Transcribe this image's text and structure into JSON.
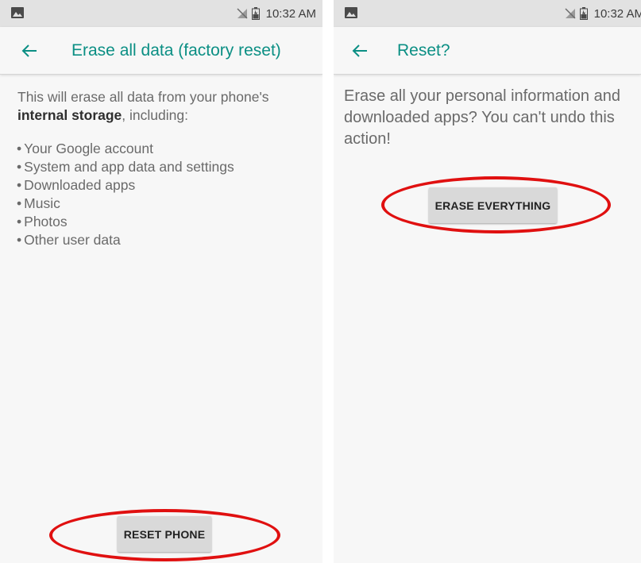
{
  "status_bar": {
    "time": "10:32 AM"
  },
  "left_screen": {
    "title": "Erase all data (factory reset)",
    "intro_prefix": "This will erase all data from your phone's",
    "intro_bold": "internal storage",
    "intro_suffix": ", including:",
    "items": [
      "Your Google account",
      "System and app data and settings",
      "Downloaded apps",
      "Music",
      "Photos",
      "Other user data"
    ],
    "button_label": "RESET PHONE"
  },
  "right_screen": {
    "title": "Reset?",
    "message": "Erase all your personal information and downloaded apps? You can't undo this action!",
    "button_label": "ERASE EVERYTHING"
  },
  "colors": {
    "accent": "#0b8f84",
    "callout": "#e01010",
    "status_bar": "#e2e2e2",
    "background": "#f7f7f7"
  }
}
